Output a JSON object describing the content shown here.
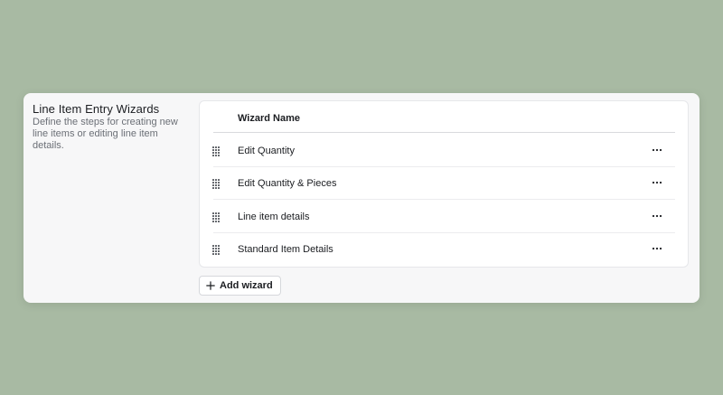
{
  "section": {
    "title": "Line Item Entry Wizards",
    "description": "Define the steps for creating new line items or editing line item details."
  },
  "table": {
    "column_header": "Wizard Name",
    "rows": [
      {
        "name": "Edit Quantity"
      },
      {
        "name": "Edit Quantity & Pieces"
      },
      {
        "name": "Line item details"
      },
      {
        "name": "Standard Item Details"
      }
    ]
  },
  "actions": {
    "add_label": "Add wizard"
  },
  "icons": {
    "drag": "drag-handle-icon",
    "more": "more-horizontal-icon",
    "add": "plus-icon"
  },
  "colors": {
    "background": "#a8baa3",
    "panel": "#f7f7f8",
    "card": "#ffffff",
    "text": "#1b1d21",
    "muted": "#6b6f76"
  }
}
